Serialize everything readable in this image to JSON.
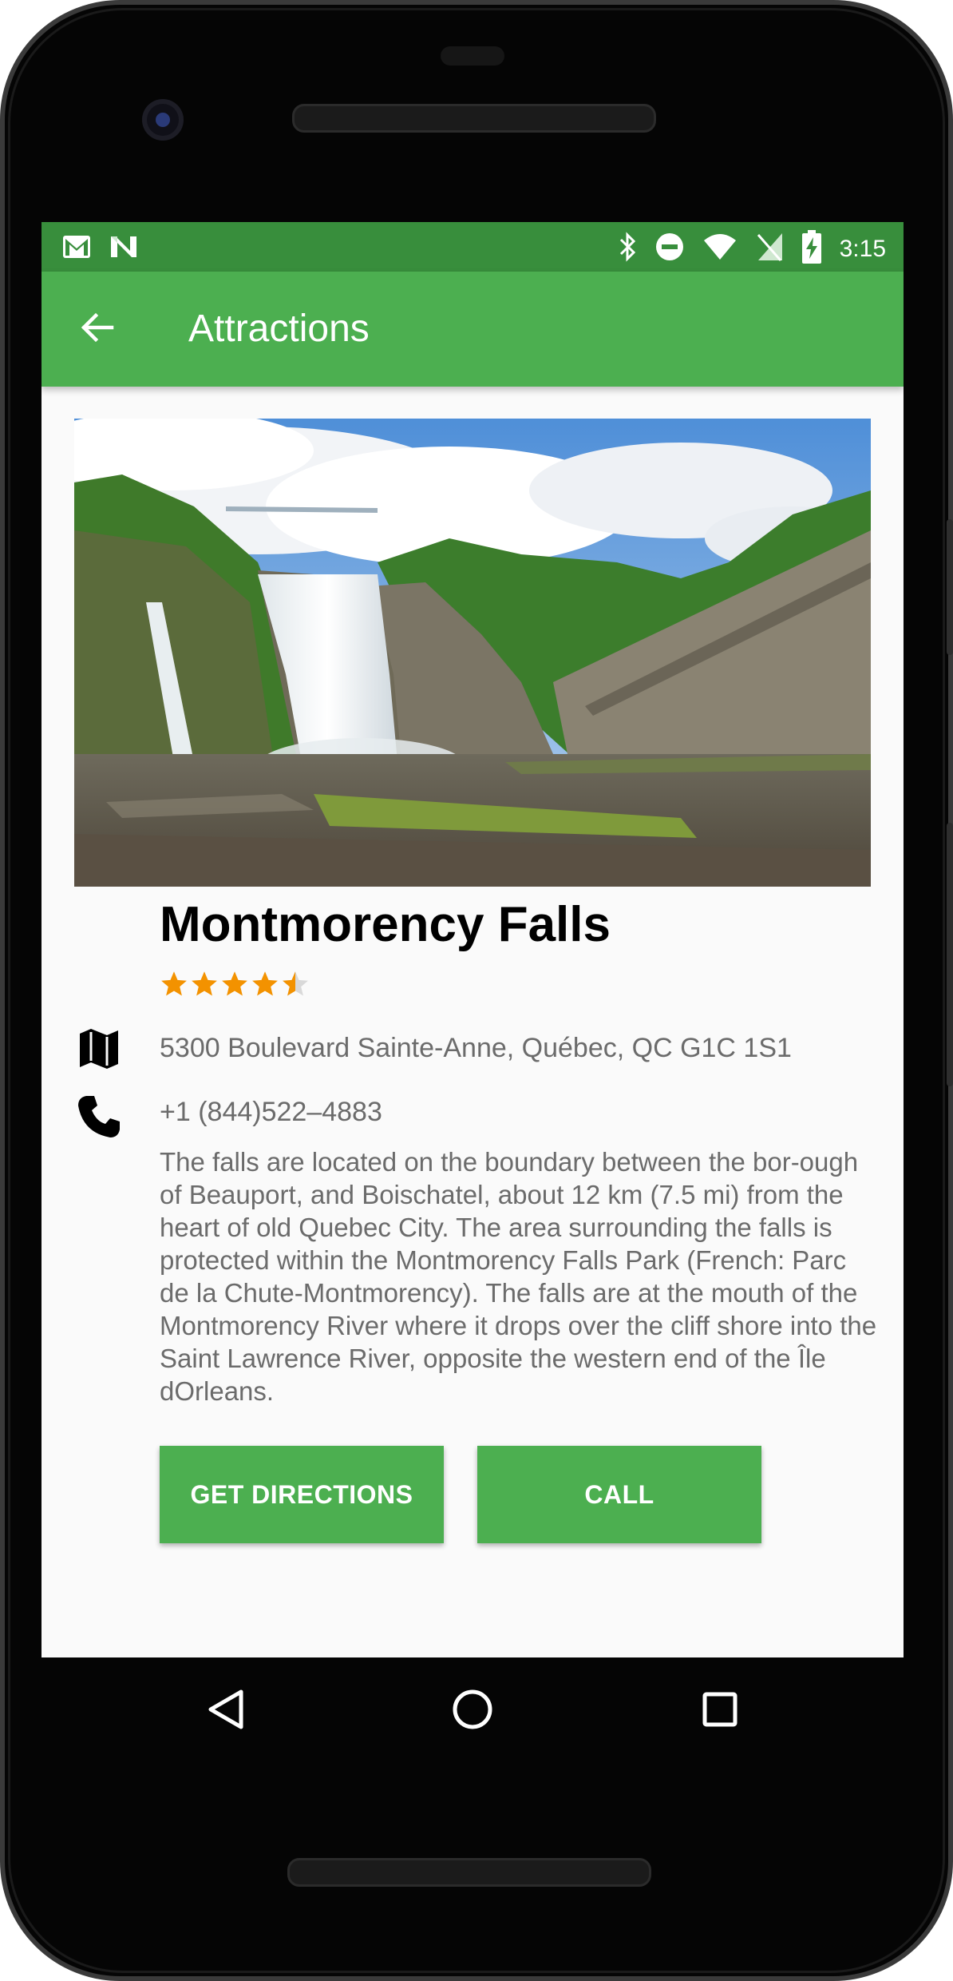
{
  "status_bar": {
    "time": "3:15",
    "left_icons": [
      "gmail-icon",
      "n-app-icon"
    ],
    "right_icons": [
      "bluetooth-icon",
      "do-not-disturb-icon",
      "wifi-icon",
      "no-sim-icon",
      "battery-charging-icon"
    ]
  },
  "app_bar": {
    "title": "Attractions",
    "back_icon": "arrow-back-icon"
  },
  "attraction": {
    "name": "Montmorency Falls",
    "rating": 4.5,
    "rating_max": 5,
    "address": "5300 Boulevard Sainte-Anne, Québec, QC G1C 1S1",
    "phone": "+1 (844)522–4883",
    "description": "The falls are located on the boundary between the bor-ough of Beauport, and Boischatel, about 12 km (7.5 mi) from the heart of old Quebec City. The area surrounding the falls is protected within the Montmorency Falls Park (French: Parc de la Chute-Montmorency). The falls are at the mouth of the Montmorency River where it drops over the cliff shore into the Saint Lawrence River, opposite the western end of the Île dOrleans."
  },
  "buttons": {
    "directions": "GET DIRECTIONS",
    "call": "CALL"
  },
  "nav_bar": {
    "icons": [
      "back-triangle-icon",
      "home-circle-icon",
      "recents-square-icon"
    ]
  },
  "colors": {
    "status_bar": "#388e3c",
    "app_bar": "#4caf50",
    "button": "#4caf50",
    "star": "#f39200",
    "secondary_text": "#6b6b6b"
  }
}
